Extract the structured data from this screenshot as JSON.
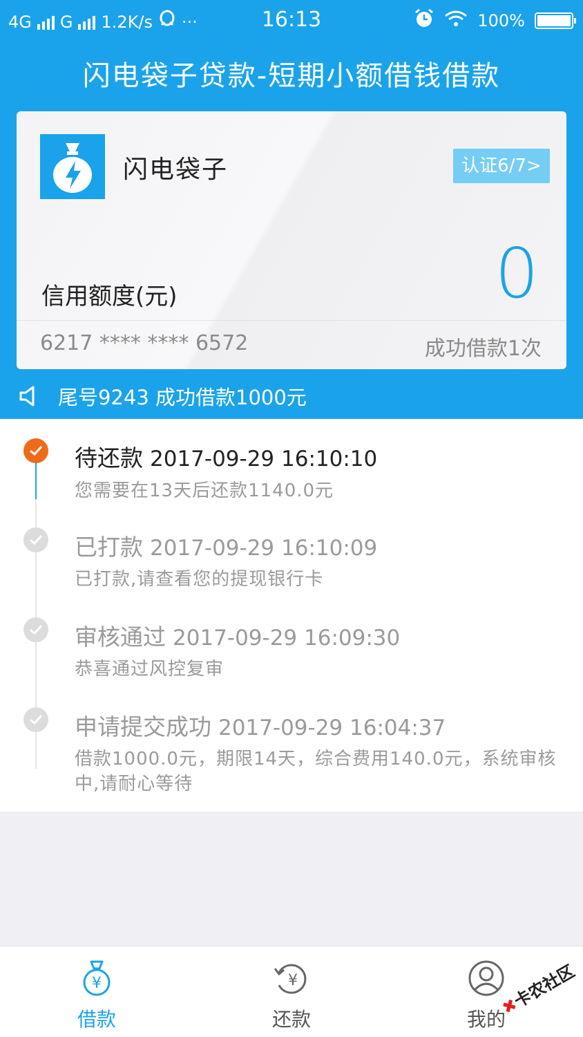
{
  "status_bar": {
    "network_1": "4G",
    "network_2": "G",
    "speed": "1.2K/s",
    "more": "···",
    "time": "16:13",
    "battery": "100%"
  },
  "app_title": "闪电袋子贷款-短期小额借钱借款",
  "card": {
    "brand_name": "闪电袋子",
    "verify_badge": "认证6/7>",
    "credit_label": "信用额度(元)",
    "credit_value": "0",
    "card_number": "6217 **** **** 6572",
    "borrow_count": "成功借款1次"
  },
  "notice": {
    "text": "尾号9243 成功借款1000元"
  },
  "timeline": [
    {
      "status": "待还款",
      "time": "2017-09-29 16:10:10",
      "desc": "您需要在13天后还款1140.0元",
      "active": true
    },
    {
      "status": "已打款",
      "time": "2017-09-29 16:10:09",
      "desc": "已打款,请查看您的提现银行卡",
      "active": false
    },
    {
      "status": "审核通过",
      "time": "2017-09-29 16:09:30",
      "desc": "恭喜通过风控复审",
      "active": false
    },
    {
      "status": "申请提交成功",
      "time": "2017-09-29 16:04:37",
      "desc": "借款1000.0元，期限14天，综合费用140.0元，系统审核中,请耐心等待",
      "active": false
    }
  ],
  "bottom_nav": {
    "items": [
      {
        "label": "借款",
        "icon": "money-bag-yen-icon",
        "active": true
      },
      {
        "label": "还款",
        "icon": "repay-yen-icon",
        "active": false
      },
      {
        "label": "我的",
        "icon": "user-icon",
        "active": false
      }
    ]
  },
  "watermark": "卡农社区",
  "colors": {
    "primary": "#1aa3ea",
    "active_dot": "#ef6b1a",
    "badge": "#76cdf4"
  }
}
